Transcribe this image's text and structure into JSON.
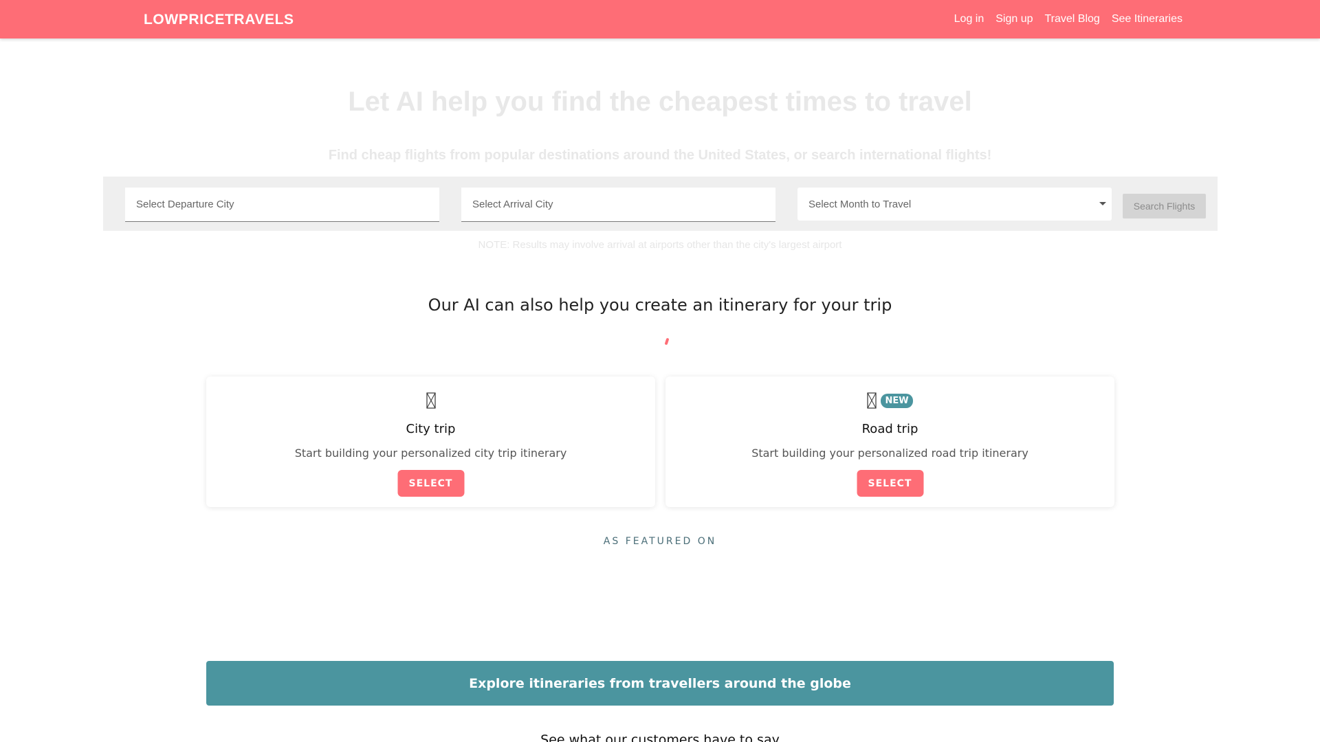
{
  "header": {
    "brand": "LOWPRICETRAVELS",
    "nav": [
      "Log in",
      "Sign up",
      "Travel Blog",
      "See Itineraries"
    ]
  },
  "hero": {
    "title": "Let AI help you find the cheapest times to travel",
    "subtitle": "Find cheap flights from popular destinations around the United States, or search international flights!"
  },
  "search": {
    "departure_placeholder": "Select Departure City",
    "arrival_placeholder": "Select Arrival City",
    "month_selected": "Select Month to Travel",
    "button_label": "Search Flights",
    "note": "NOTE: Results may involve arrival at airports other than the city's largest airport"
  },
  "itinerary": {
    "heading": "Our AI can also help you create an itinerary for your trip",
    "cards": [
      {
        "icon": "building-icon",
        "title": "City trip",
        "description": "Start building your personalized city trip itinerary",
        "button": "SELECT"
      },
      {
        "icon": "car-icon",
        "badge": "NEW",
        "title": "Road trip",
        "description": "Start building your personalized road trip itinerary",
        "button": "SELECT"
      }
    ]
  },
  "featured_label": "AS FEATURED ON",
  "explore_button": "Explore itineraries from travellers around the globe",
  "testimonials_heading": "See what our customers have to say",
  "colors": {
    "brand": "#fe6d76",
    "teal": "#4b959f"
  }
}
